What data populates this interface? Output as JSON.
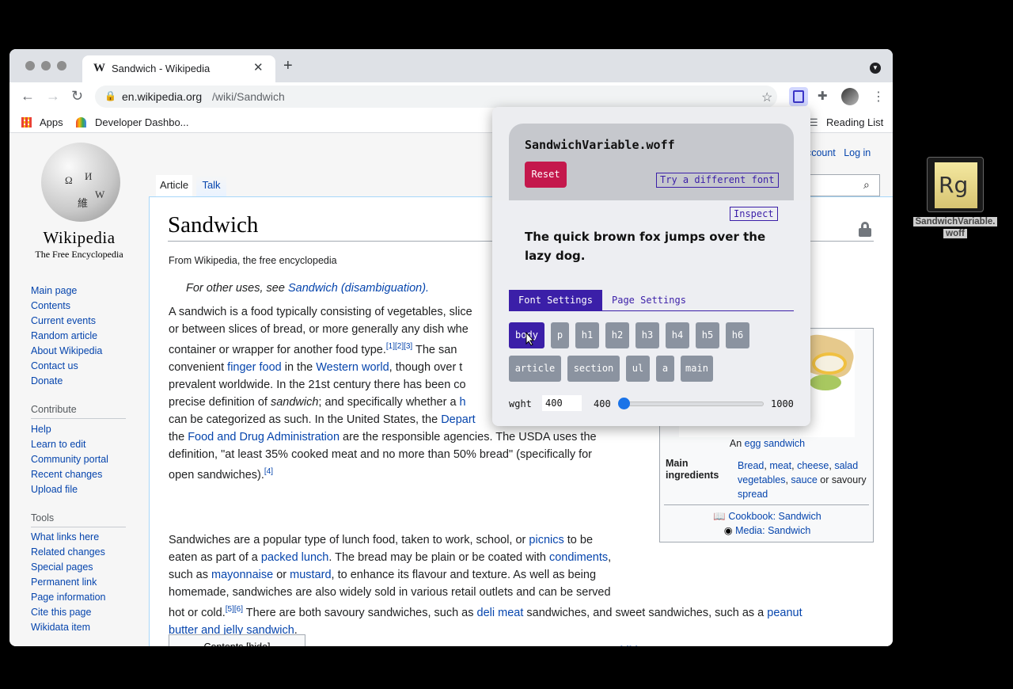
{
  "browser": {
    "tab_title": "Sandwich - Wikipedia",
    "tab_icon": "W",
    "url_host": "en.wikipedia.org",
    "url_path": "/wiki/Sandwich",
    "bookmarks": {
      "apps": "Apps",
      "developer": "Developer Dashbo...",
      "reading_list": "Reading List"
    }
  },
  "wiki": {
    "wordmark": "Wikipedia",
    "tagline": "The Free Encyclopedia",
    "nav_main": [
      "Main page",
      "Contents",
      "Current events",
      "Random article",
      "About Wikipedia",
      "Contact us",
      "Donate"
    ],
    "contribute_heading": "Contribute",
    "nav_contribute": [
      "Help",
      "Learn to edit",
      "Community portal",
      "Recent changes",
      "Upload file"
    ],
    "tools_heading": "Tools",
    "nav_tools": [
      "What links here",
      "Related changes",
      "Special pages",
      "Permanent link",
      "Page information",
      "Cite this page",
      "Wikidata item"
    ],
    "tab_article": "Article",
    "tab_talk": "Talk",
    "personal_account": "account",
    "personal_login": "Log in",
    "title": "Sandwich",
    "subtitle": "From Wikipedia, the free encyclopedia",
    "hatnote_prefix": "For other uses, see ",
    "hatnote_link": "Sandwich (disambiguation).",
    "infobox": {
      "caption_prefix": "An ",
      "caption_link": "egg sandwich",
      "label": "Main ingredients",
      "cookbook": "Cookbook: Sandwich",
      "media": "Media: Sandwich"
    },
    "contents_label": "Contents [hide]"
  },
  "popup": {
    "filename": "SandwichVariable.woff",
    "reset": "Reset",
    "try_font": "Try a different font",
    "inspect": "Inspect",
    "preview": "The quick brown fox jumps over the lazy dog.",
    "tab_font": "Font Settings",
    "tab_page": "Page Settings",
    "elements_row1": [
      "body",
      "p",
      "h1",
      "h2",
      "h3",
      "h4",
      "h5",
      "h6"
    ],
    "elements_row2": [
      "article",
      "section",
      "ul",
      "a",
      "main"
    ],
    "selected_element": "body",
    "axis_label": "wght",
    "axis_value": "400",
    "axis_min": "400",
    "axis_max": "1000",
    "axis_level": 0.0
  },
  "desktop": {
    "file_icon_text": "Rg",
    "file_name_line1": "SandwichVariable.",
    "file_name_line2": "woff"
  }
}
